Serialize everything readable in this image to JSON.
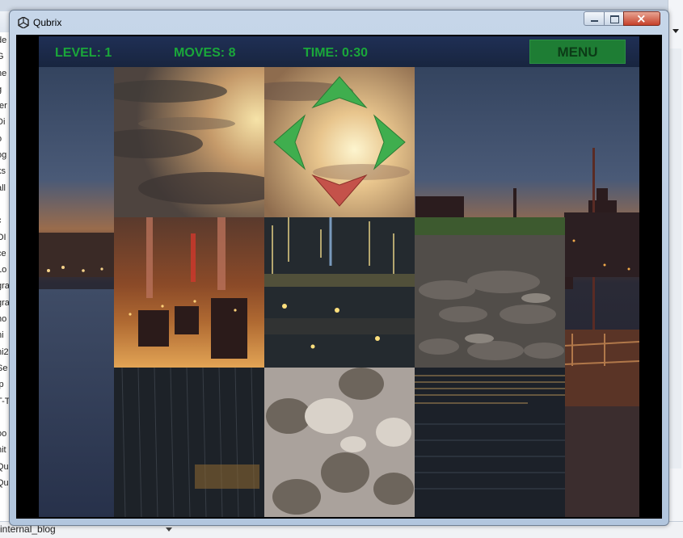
{
  "window": {
    "title": "Qubrix"
  },
  "hud": {
    "level": "LEVEL: 1",
    "moves": "MOVES: 8",
    "time": "TIME: 0:30",
    "menu": "MENU"
  },
  "background": {
    "left_fragments": [
      "de",
      "G",
      "ne",
      "g",
      "ter",
      "Di",
      "o",
      "og",
      "ks",
      "all",
      "",
      "c",
      "OI",
      "ce",
      "Lo",
      "gra",
      "gra",
      "no",
      "ni",
      "ni2",
      "Se",
      "ip",
      "T-Ta",
      "",
      "oo",
      "nit",
      "Qu",
      "Qu"
    ],
    "bottom_text": "internal_blog"
  },
  "colors": {
    "hud_text": "#1aa73a",
    "menu_bg": "#1e7d34",
    "arrow_green": "#3fae4e",
    "arrow_red": "#c4524a"
  },
  "board": {
    "rows": 3,
    "cols": 4,
    "tiles": [
      {
        "content": "cloudy sky at sunset"
      },
      {
        "content": "sunset sky with direction arrows"
      },
      {
        "content": ""
      },
      {
        "content": ""
      },
      {
        "content": "city lights reflected in water, inverted"
      },
      {
        "content": "night reflections on water"
      },
      {
        "content": "mossy stones"
      },
      {
        "content": ""
      },
      {
        "content": "dark water with light streaks"
      },
      {
        "content": "pebbles and rocks"
      },
      {
        "content": "dark rippled water"
      },
      {
        "content": ""
      }
    ],
    "direction_arrows": [
      "up-arrow",
      "left-arrow",
      "right-arrow",
      "down-arrow"
    ]
  }
}
